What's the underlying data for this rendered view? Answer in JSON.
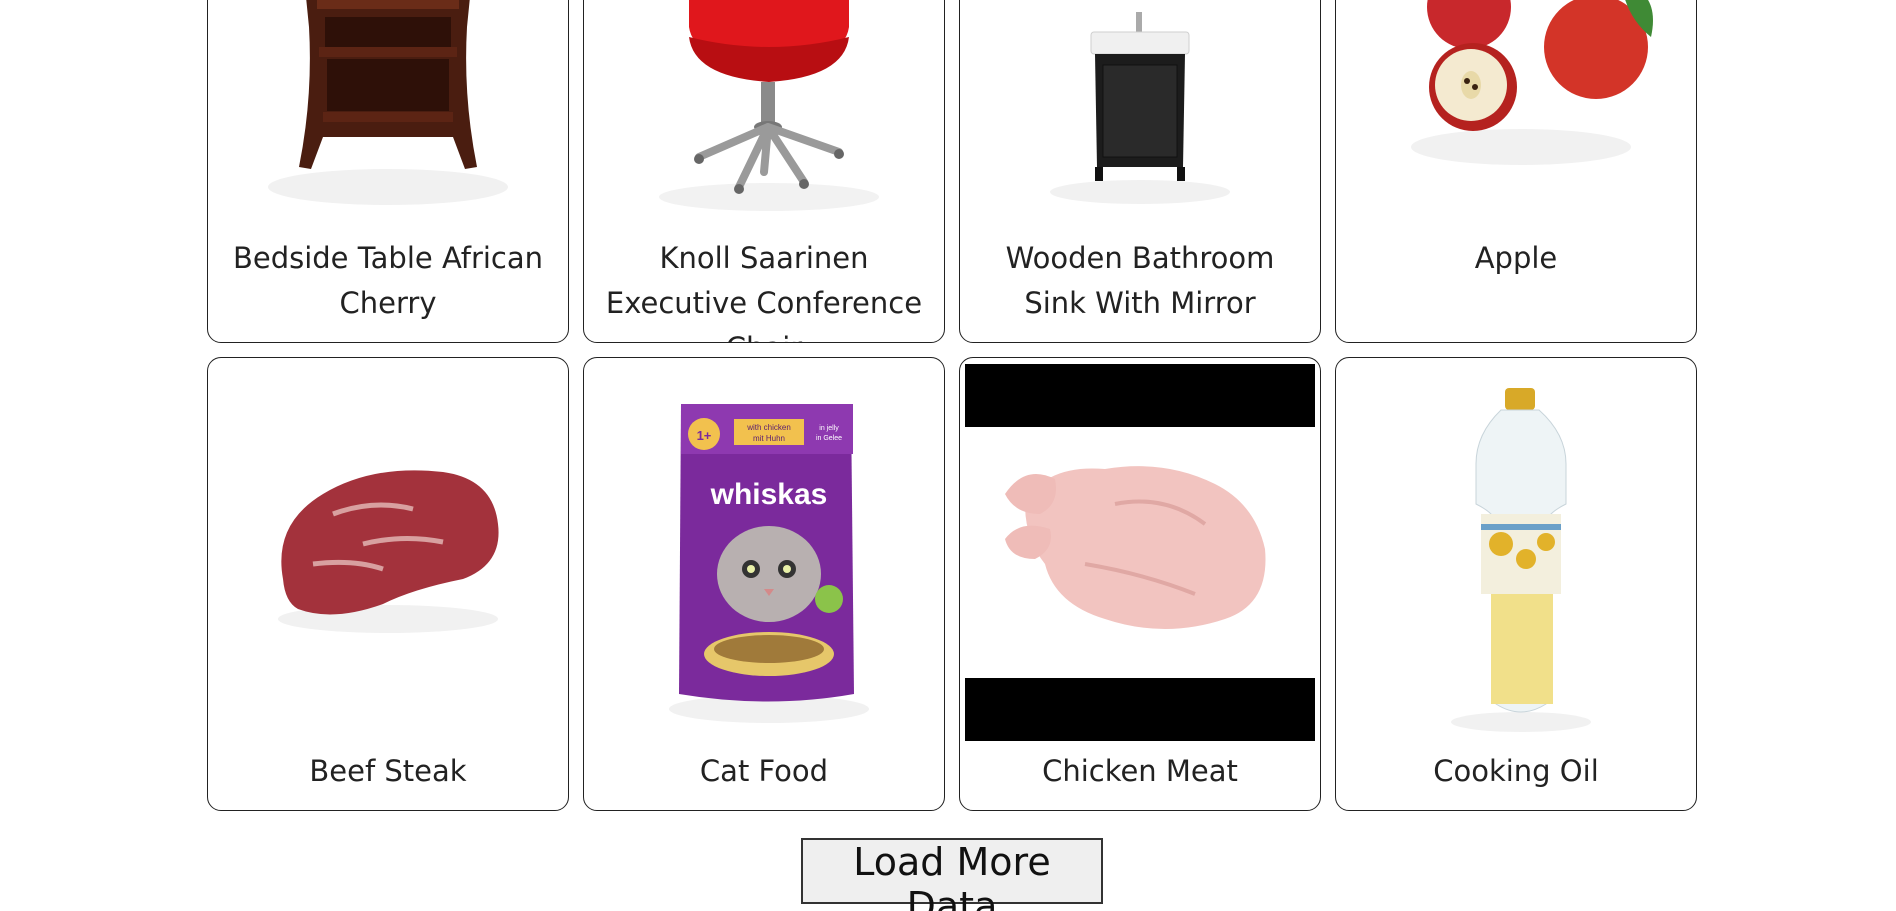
{
  "products": [
    {
      "name": "Bedside Table African Cherry",
      "icon": "bedside-table-image"
    },
    {
      "name": "Knoll Saarinen Executive Conference Chair",
      "icon": "office-chair-image"
    },
    {
      "name": "Wooden Bathroom Sink With Mirror",
      "icon": "bathroom-sink-image"
    },
    {
      "name": "Apple",
      "icon": "apple-image"
    },
    {
      "name": "Beef Steak",
      "icon": "beef-steak-image"
    },
    {
      "name": "Cat Food",
      "icon": "cat-food-image"
    },
    {
      "name": "Chicken Meat",
      "icon": "chicken-meat-image"
    },
    {
      "name": "Cooking Oil",
      "icon": "cooking-oil-image"
    }
  ],
  "cat_food_pack": {
    "brand": "whiskas",
    "age_badge": "1+",
    "flavor_line1": "with chicken",
    "flavor_line2": "mit Huhn",
    "side_line1": "in jelly",
    "side_line2": "in Gelee"
  },
  "load_more_label": "Load More Data"
}
